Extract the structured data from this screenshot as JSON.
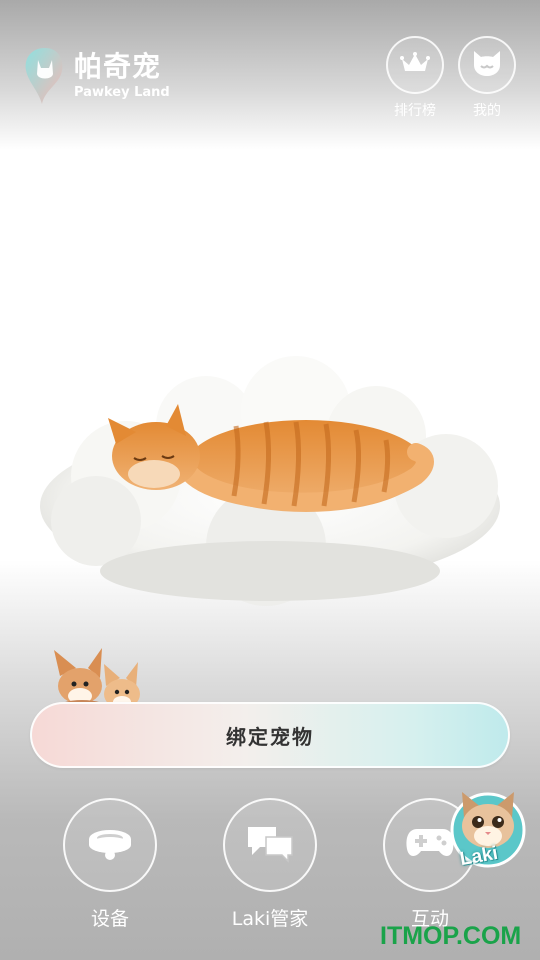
{
  "brand": {
    "name_cn": "帕奇宠",
    "name_en": "Pawkey Land"
  },
  "top_actions": [
    {
      "label": "排行榜",
      "icon": "crown-icon"
    },
    {
      "label": "我的",
      "icon": "cat-face-icon"
    }
  ],
  "hero": {
    "subject": "sleeping-cat-on-cloud"
  },
  "bind_button": {
    "label": "绑定宠物"
  },
  "bottom_nav": [
    {
      "label": "设备",
      "icon": "pet-collar-icon"
    },
    {
      "label": "Laki管家",
      "icon": "chat-bubbles-icon"
    },
    {
      "label": "互动",
      "icon": "gamepad-icon"
    }
  ],
  "assistant": {
    "badge_text": "Laki"
  },
  "watermark": "ITMOP.COM",
  "colors": {
    "accent_pink": "#f6d9d6",
    "accent_teal": "#bfeaec",
    "watermark": "#1aa34a"
  }
}
